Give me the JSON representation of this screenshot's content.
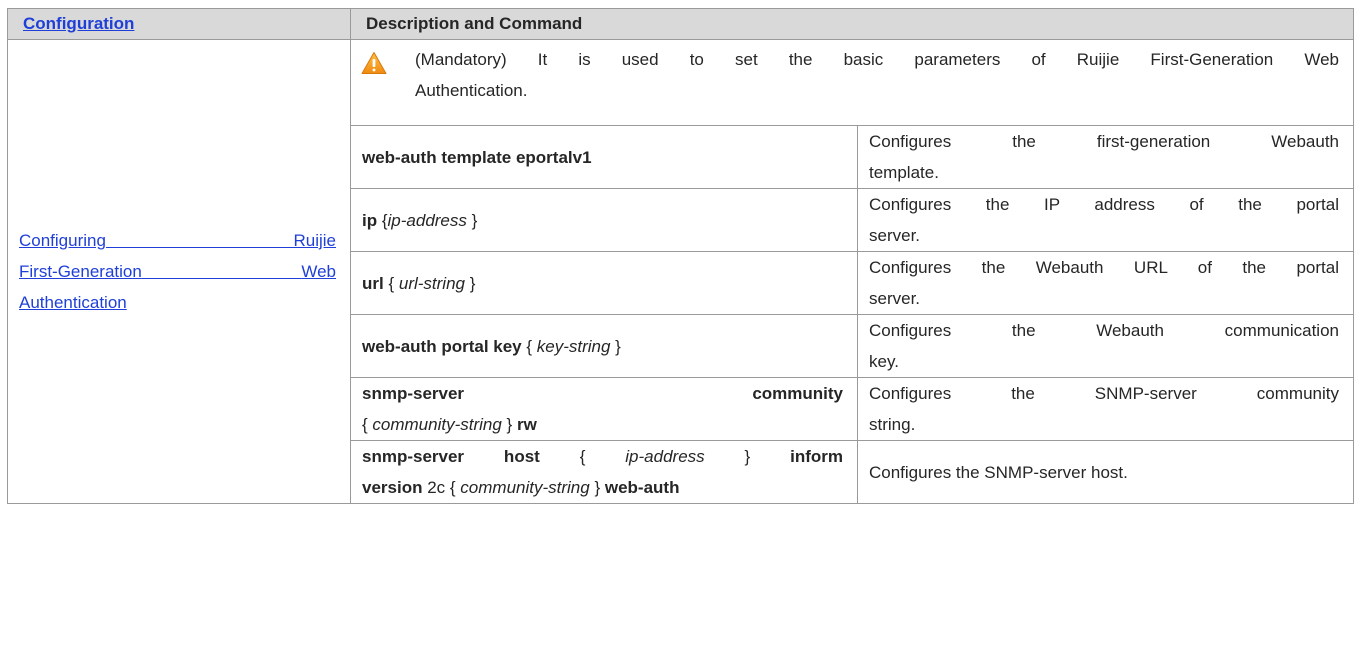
{
  "header": {
    "col1": "Configuration",
    "col2": "Description and Command"
  },
  "left": {
    "line1_a": "Configuring",
    "line1_b": "Ruijie",
    "line2_a": "First-Generation",
    "line2_b": "Web",
    "line3": "Authentication"
  },
  "notice": {
    "icon": "warning-icon",
    "line1": "(Mandatory) It is used to set the basic parameters of Ruijie First-Generation Web",
    "line2": "Authentication."
  },
  "rows": [
    {
      "cmd_bold": "web-auth template eportalv1",
      "desc_line1": "Configures the first-generation Webauth",
      "desc_line2": "template."
    },
    {
      "cmd_bold": "ip",
      "cmd_open": " {",
      "cmd_italic": "ip-address",
      "cmd_close": " }",
      "desc_line1": "Configures the IP address of the portal",
      "desc_line2": "server."
    },
    {
      "cmd_bold": "url",
      "cmd_open": " { ",
      "cmd_italic": "url-string",
      "cmd_close": " }",
      "desc_line1": "Configures the Webauth URL of the portal",
      "desc_line2": "server."
    },
    {
      "cmd_bold": "web-auth portal key",
      "cmd_open": " { ",
      "cmd_italic": "key-string",
      "cmd_close": " }",
      "desc_line1": "Configures the Webauth communication",
      "desc_line2": "key."
    },
    {
      "cmd_line1_a": "snmp-server",
      "cmd_line1_b": "community",
      "cmd_line2_open": "{ ",
      "cmd_line2_italic": "community-string",
      "cmd_line2_close": " } ",
      "cmd_line2_bold": "rw",
      "desc_line1": "Configures the SNMP-server community",
      "desc_line2": "string."
    },
    {
      "cmd_line1_bold1": "snmp-server host",
      "cmd_line1_open": " { ",
      "cmd_line1_italic": "ip-address",
      "cmd_line1_close": " } ",
      "cmd_line1_bold2": "inform",
      "cmd_line2_bold1": "version",
      "cmd_line2_plain": " 2c { ",
      "cmd_line2_italic": "community-string",
      "cmd_line2_close": " } ",
      "cmd_line2_bold2": "web-auth",
      "desc": "Configures the SNMP-server host."
    }
  ],
  "colors": {
    "header_bg": "#d9d9d9",
    "link": "#1f3fd8",
    "warning": "#f5a623"
  }
}
